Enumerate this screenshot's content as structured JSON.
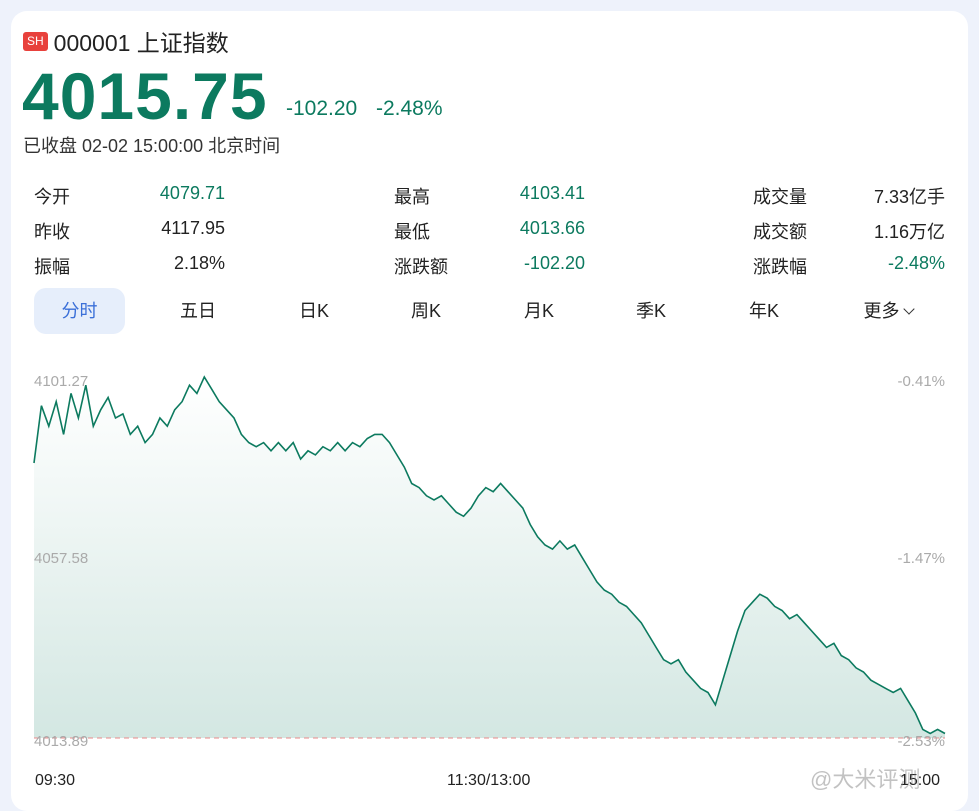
{
  "header": {
    "market_badge": "SH",
    "code_name": "000001 上证指数",
    "price": "4015.75",
    "change": "-102.20",
    "change_pct": "-2.48%",
    "status": "已收盘 02-02 15:00:00 北京时间"
  },
  "stats": {
    "col1": [
      {
        "label": "今开",
        "value": "4079.71",
        "color": "green"
      },
      {
        "label": "昨收",
        "value": "4117.95",
        "color": "dark"
      },
      {
        "label": "振幅",
        "value": "2.18%",
        "color": "dark"
      }
    ],
    "col2": [
      {
        "label": "最高",
        "value": "4103.41",
        "color": "green"
      },
      {
        "label": "最低",
        "value": "4013.66",
        "color": "green"
      },
      {
        "label": "涨跌额",
        "value": "-102.20",
        "color": "green"
      }
    ],
    "col3": [
      {
        "label": "成交量",
        "value": "7.33亿手",
        "color": "dark"
      },
      {
        "label": "成交额",
        "value": "1.16万亿",
        "color": "dark"
      },
      {
        "label": "涨跌幅",
        "value": "-2.48%",
        "color": "green"
      }
    ]
  },
  "tabs": {
    "active": "分时",
    "items": [
      "分时",
      "五日",
      "日K",
      "周K",
      "月K",
      "季K",
      "年K",
      "更多"
    ]
  },
  "colors": {
    "down": "#0c7a5f",
    "badge": "#e8413c",
    "active_tab_bg": "#e6eefb",
    "active_tab_text": "#3a6fd8",
    "baseline": "#e88a8a"
  },
  "chart_data": {
    "type": "area",
    "y_left_ticks": [
      "4101.27",
      "4057.58",
      "4013.89"
    ],
    "y_right_ticks": [
      "-0.41%",
      "-1.47%",
      "-2.53%"
    ],
    "x_ticks": [
      "09:30",
      "11:30/13:00",
      "15:00"
    ],
    "ylim": [
      4013.89,
      4101.27
    ],
    "series": [
      {
        "values": [
          4081,
          4095,
          4090,
          4096,
          4088,
          4098,
          4092,
          4100,
          4090,
          4094,
          4097,
          4092,
          4093,
          4088,
          4090,
          4086,
          4088,
          4092,
          4090,
          4094,
          4096,
          4100,
          4098,
          4102,
          4099,
          4096,
          4094,
          4092,
          4088,
          4086,
          4085,
          4086,
          4084,
          4086,
          4084,
          4086,
          4082,
          4084,
          4083,
          4085,
          4084,
          4086,
          4084,
          4086,
          4085,
          4087,
          4088,
          4088,
          4086,
          4083,
          4080,
          4076,
          4075,
          4073,
          4072,
          4073,
          4071,
          4069,
          4068,
          4070,
          4073,
          4075,
          4074,
          4076,
          4074,
          4072,
          4070,
          4066,
          4063,
          4061,
          4060,
          4062,
          4060,
          4061,
          4058,
          4055,
          4052,
          4050,
          4049,
          4047,
          4046,
          4044,
          4042,
          4039,
          4036,
          4033,
          4032,
          4033,
          4030,
          4028,
          4026,
          4025,
          4022,
          4028,
          4034,
          4040,
          4045,
          4047,
          4049,
          4048,
          4046,
          4045,
          4043,
          4044,
          4042,
          4040,
          4038,
          4036,
          4037,
          4034,
          4033,
          4031,
          4030,
          4028,
          4027,
          4026,
          4025,
          4026,
          4023,
          4020,
          4016,
          4015,
          4016,
          4015
        ]
      }
    ],
    "baseline": 4013.89
  },
  "watermark": "@大米评测"
}
